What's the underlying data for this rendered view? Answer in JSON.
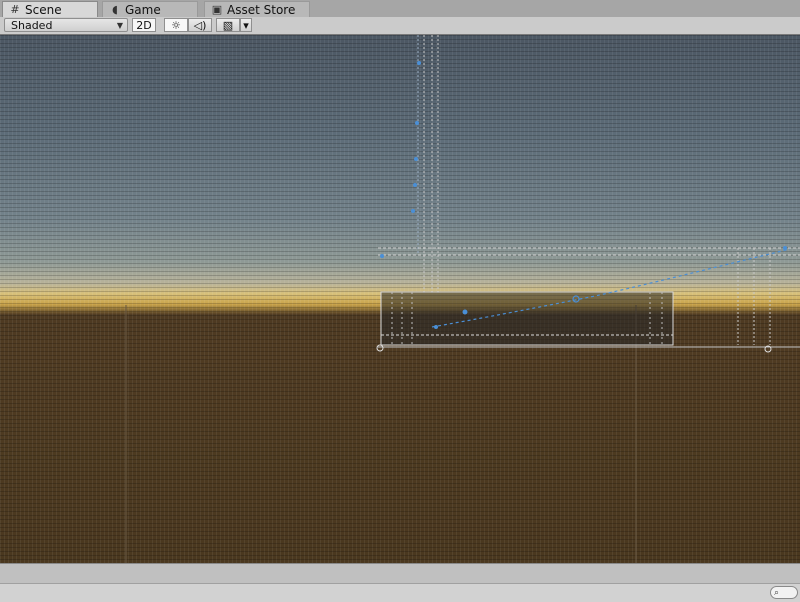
{
  "tabs": [
    {
      "label": "Scene",
      "icon": "grid-icon",
      "glyph": "#",
      "active": true
    },
    {
      "label": "Game",
      "icon": "pacman-icon",
      "glyph": "◖",
      "active": false
    },
    {
      "label": "Asset Store",
      "icon": "shopping-bag-icon",
      "glyph": "▣",
      "active": false
    }
  ],
  "toolbar": {
    "shading_mode": "Shaded",
    "two_d_label": "2D",
    "lighting_glyph": "☼",
    "audio_glyph": "◁)",
    "effects_glyph": "▧",
    "effects_caret": "▾"
  },
  "search": {
    "glyph": "⌕"
  },
  "colors": {
    "gizmo_line": "#dcdcdc",
    "gizmo_accent": "#4a8fd6"
  }
}
